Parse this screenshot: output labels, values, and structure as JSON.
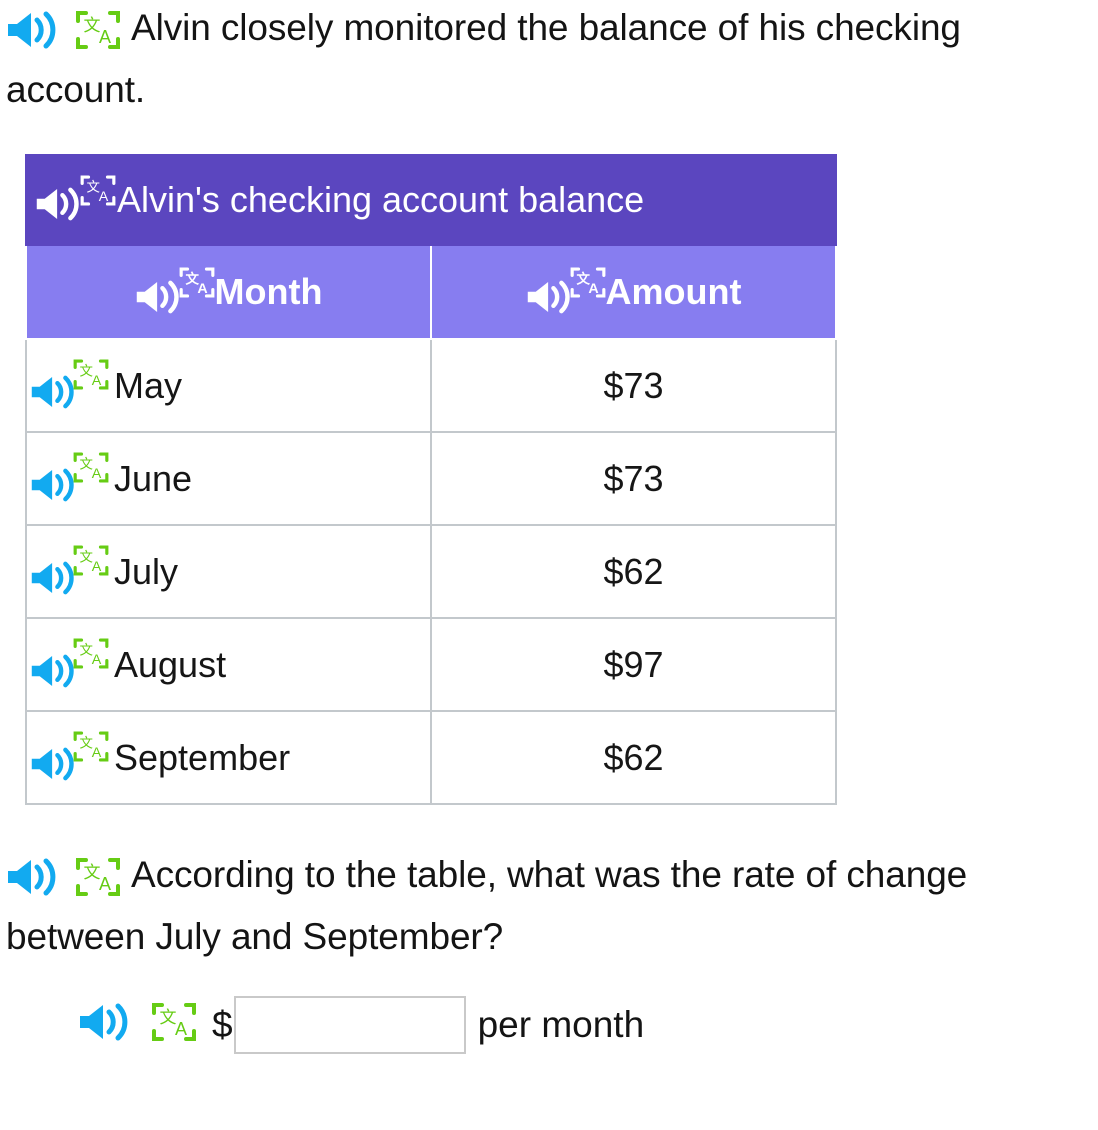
{
  "colors": {
    "speaker_icon": "#12aaf0",
    "speaker_icon_white": "#ffffff",
    "translate_icon": "#66cc14",
    "translate_icon_white": "#ffffff",
    "table_title_bg": "#5b46bf",
    "table_col_head_bg": "#877df0",
    "table_border": "#c3c8cc",
    "text": "#141414",
    "input_border": "#c9c9c9"
  },
  "prompt": {
    "speaker_icon": "speaker-icon",
    "translate_icon": "translate-icon",
    "text": "Alvin closely monitored the balance of his checking account."
  },
  "table": {
    "title": "Alvin's checking account balance",
    "title_speaker_icon": "speaker-icon",
    "title_translate_icon": "translate-icon",
    "columns": [
      {
        "label": "Month",
        "speaker_icon": "speaker-icon",
        "translate_icon": "translate-icon"
      },
      {
        "label": "Amount",
        "speaker_icon": "speaker-icon",
        "translate_icon": "translate-icon"
      }
    ],
    "rows": [
      {
        "month": "May",
        "amount": "$73"
      },
      {
        "month": "June",
        "amount": "$73"
      },
      {
        "month": "July",
        "amount": "$62"
      },
      {
        "month": "August",
        "amount": "$97"
      },
      {
        "month": "September",
        "amount": "$62"
      }
    ]
  },
  "question": {
    "speaker_icon": "speaker-icon",
    "translate_icon": "translate-icon",
    "text": "According to the table, what was the rate of change between July and September?"
  },
  "answer": {
    "speaker_icon": "speaker-icon",
    "translate_icon": "translate-icon",
    "currency_symbol": "$",
    "input_value": "",
    "input_placeholder": "",
    "unit_label": "per month"
  },
  "chart_data": {
    "type": "table",
    "title": "Alvin's checking account balance",
    "categories": [
      "May",
      "June",
      "July",
      "August",
      "September"
    ],
    "values": [
      73,
      73,
      62,
      97,
      62
    ],
    "xlabel": "Month",
    "ylabel": "Amount",
    "units": "USD"
  }
}
